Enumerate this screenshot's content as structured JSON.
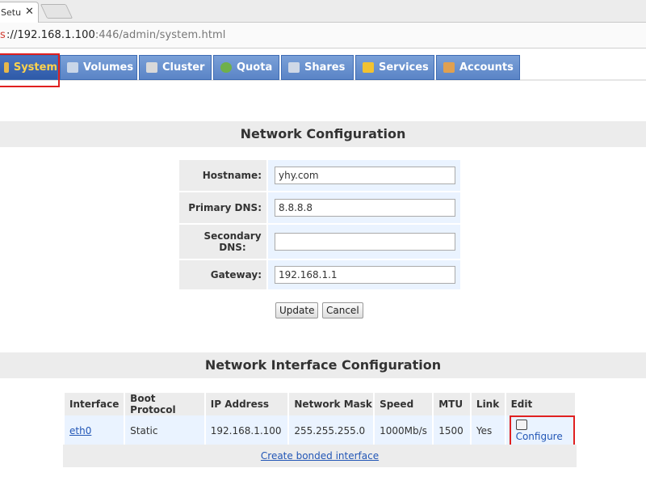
{
  "browser": {
    "tab_title": "Setu",
    "tab_close": "✕",
    "address_insecure_marker": "s",
    "address_url_host": "://192.168.1.100",
    "address_url_rest": ":446/admin/system.html"
  },
  "nav": {
    "tabs": [
      {
        "label": "System",
        "icon": "system-icon",
        "icon_color": "#e8b84a",
        "active": true
      },
      {
        "label": "Volumes",
        "icon": "volumes-icon",
        "icon_color": "#c9d6e8"
      },
      {
        "label": "Cluster",
        "icon": "cluster-icon",
        "icon_color": "#d9d9d9"
      },
      {
        "label": "Quota",
        "icon": "quota-icon",
        "icon_color": "#6fb04a"
      },
      {
        "label": "Shares",
        "icon": "shares-icon",
        "icon_color": "#cfd8e6"
      },
      {
        "label": "Services",
        "icon": "services-icon",
        "icon_color": "#f2c230"
      },
      {
        "label": "Accounts",
        "icon": "accounts-icon",
        "icon_color": "#e0a050"
      }
    ],
    "active_color": "#ffd34d"
  },
  "network_config": {
    "title": "Network Configuration",
    "hostname_label": "Hostname:",
    "hostname_value": "yhy.com",
    "primary_dns_label": "Primary DNS:",
    "primary_dns_value": "8.8.8.8",
    "secondary_dns_label": "Secondary DNS:",
    "secondary_dns_value": "",
    "gateway_label": "Gateway:",
    "gateway_value": "192.168.1.1",
    "update_button": "Update",
    "cancel_button": "Cancel"
  },
  "interface_config": {
    "title": "Network Interface Configuration",
    "columns": [
      "Interface",
      "Boot Protocol",
      "IP Address",
      "Network Mask",
      "Speed",
      "MTU",
      "Link",
      "Edit"
    ],
    "rows": [
      {
        "interface": "eth0",
        "boot_protocol": "Static",
        "ip_address": "192.168.1.100",
        "network_mask": "255.255.255.0",
        "speed": "1000Mb/s",
        "mtu": "1500",
        "link": "Yes",
        "edit": "Configure"
      }
    ],
    "create_bonded": "Create bonded interface"
  },
  "colors": {
    "highlight": "#e02020",
    "nav_blue": "#5a84c6",
    "link": "#2256b6"
  }
}
